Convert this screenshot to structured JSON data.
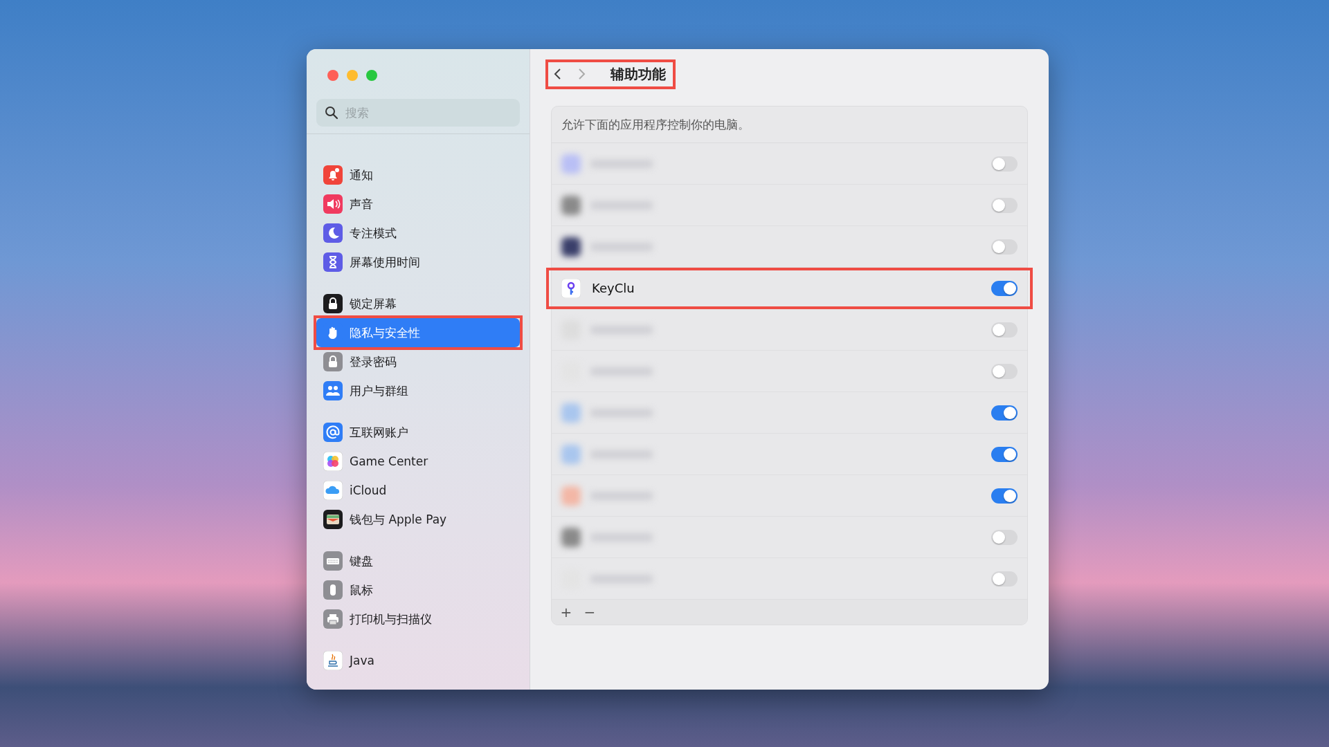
{
  "window": {
    "title": "辅助功能",
    "title_highlighted": true
  },
  "sidebar": {
    "search": {
      "placeholder": "搜索"
    },
    "groups": [
      [
        {
          "label": "通知",
          "kind": "bell",
          "selected": false,
          "highlighted": false
        },
        {
          "label": "声音",
          "kind": "speaker",
          "selected": false,
          "highlighted": false
        },
        {
          "label": "专注模式",
          "kind": "moon",
          "selected": false,
          "highlighted": false
        },
        {
          "label": "屏幕使用时间",
          "kind": "hourglass",
          "selected": false,
          "highlighted": false
        }
      ],
      [
        {
          "label": "锁定屏幕",
          "kind": "lockscreen",
          "selected": false,
          "highlighted": false
        },
        {
          "label": "隐私与安全性",
          "kind": "hand",
          "selected": true,
          "highlighted": true
        },
        {
          "label": "登录密码",
          "kind": "lock",
          "selected": false,
          "highlighted": false
        },
        {
          "label": "用户与群组",
          "kind": "people",
          "selected": false,
          "highlighted": false
        }
      ],
      [
        {
          "label": "互联网账户",
          "kind": "at",
          "selected": false,
          "highlighted": false
        },
        {
          "label": "Game Center",
          "kind": "game",
          "selected": false,
          "highlighted": false
        },
        {
          "label": "iCloud",
          "kind": "cloud",
          "selected": false,
          "highlighted": false
        },
        {
          "label": "钱包与 Apple Pay",
          "kind": "wallet",
          "selected": false,
          "highlighted": false
        }
      ],
      [
        {
          "label": "键盘",
          "kind": "keyboard",
          "selected": false,
          "highlighted": false
        },
        {
          "label": "鼠标",
          "kind": "mouse",
          "selected": false,
          "highlighted": false
        },
        {
          "label": "打印机与扫描仪",
          "kind": "printer",
          "selected": false,
          "highlighted": false
        }
      ],
      [
        {
          "label": "Java",
          "kind": "java",
          "selected": false,
          "highlighted": false
        }
      ]
    ]
  },
  "panel": {
    "description": "允许下面的应用程序控制你的电脑。",
    "apps": [
      {
        "kind": "blurred",
        "on": false,
        "highlighted": false
      },
      {
        "kind": "blurred",
        "on": false,
        "highlighted": false
      },
      {
        "kind": "blurred",
        "on": false,
        "highlighted": false
      },
      {
        "kind": "app",
        "name": "KeyClu",
        "on": true,
        "highlighted": true
      },
      {
        "kind": "blurred",
        "on": false,
        "highlighted": false
      },
      {
        "kind": "blurred",
        "on": false,
        "highlighted": false
      },
      {
        "kind": "blurred",
        "on": true,
        "highlighted": false
      },
      {
        "kind": "blurred",
        "on": true,
        "highlighted": false
      },
      {
        "kind": "blurred",
        "on": true,
        "highlighted": false
      },
      {
        "kind": "blurred",
        "on": false,
        "highlighted": false
      },
      {
        "kind": "blurred",
        "on": false,
        "highlighted": false
      }
    ],
    "footer": [
      "+",
      "−"
    ]
  }
}
